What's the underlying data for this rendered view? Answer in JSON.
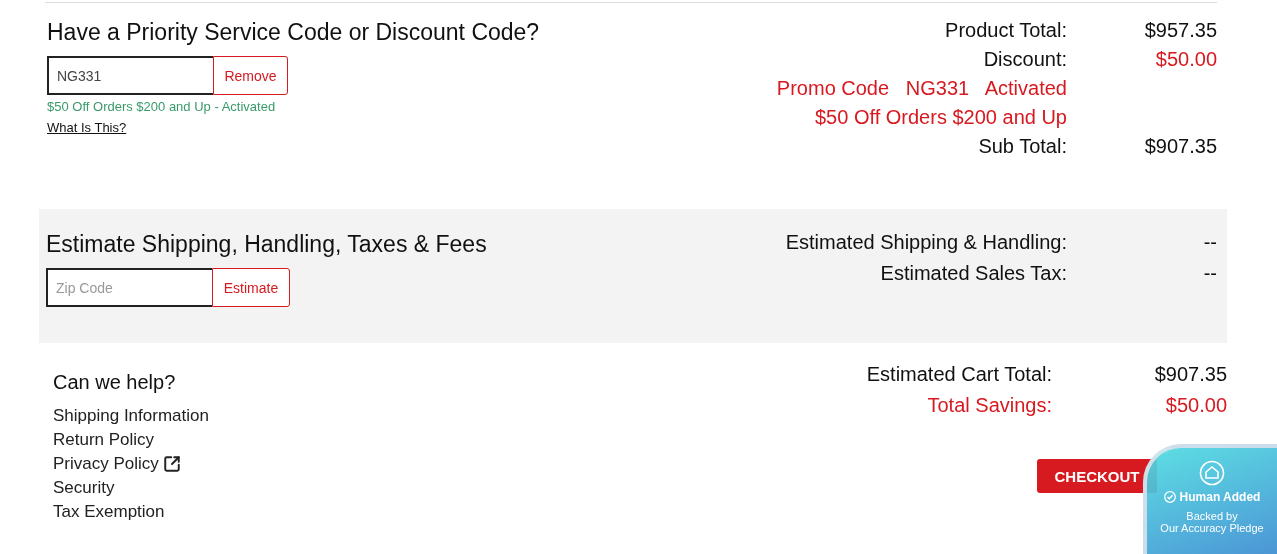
{
  "promo": {
    "title": "Have a Priority Service Code or Discount Code?",
    "value": "NG331",
    "button": "Remove",
    "status": "$50 Off Orders $200 and Up - Activated",
    "help_link": "What Is This?"
  },
  "summary": [
    {
      "kind": "amount",
      "label": "Product Total:",
      "value": "$957.35",
      "highlight_label": false,
      "highlight_value": false
    },
    {
      "kind": "amount",
      "label": "Discount:",
      "value": "$50.00",
      "highlight_label": false,
      "highlight_value": true
    },
    {
      "kind": "promo",
      "parts": [
        "Promo Code",
        "NG331",
        "Activated"
      ]
    },
    {
      "kind": "note",
      "text": "$50 Off Orders $200 and Up"
    },
    {
      "kind": "amount",
      "label": "Sub Total:",
      "value": "$907.35",
      "highlight_label": false,
      "highlight_value": false
    }
  ],
  "shipping": {
    "title": "Estimate Shipping, Handling, Taxes & Fees",
    "placeholder": "Zip Code",
    "button": "Estimate",
    "rows": [
      {
        "label": "Estimated Shipping & Handling:",
        "value": "--"
      },
      {
        "label": "Estimated Sales Tax:",
        "value": "--"
      }
    ]
  },
  "help": {
    "title": "Can we help?",
    "links": [
      {
        "label": "Shipping Information",
        "external": false
      },
      {
        "label": "Return Policy",
        "external": false
      },
      {
        "label": "Privacy Policy",
        "external": true
      },
      {
        "label": "Security",
        "external": false
      },
      {
        "label": "Tax Exemption",
        "external": false
      }
    ]
  },
  "totals": [
    {
      "label": "Estimated Cart Total:",
      "value": "$907.35",
      "highlight_label": false,
      "highlight_value": false
    },
    {
      "label": "Total Savings:",
      "value": "$50.00",
      "highlight_label": true,
      "highlight_value": true
    }
  ],
  "checkout": "CHECKOUT",
  "badge": {
    "title": "Human Added",
    "subtitle": "Backed by",
    "detail": "Our Accuracy Pledge"
  }
}
